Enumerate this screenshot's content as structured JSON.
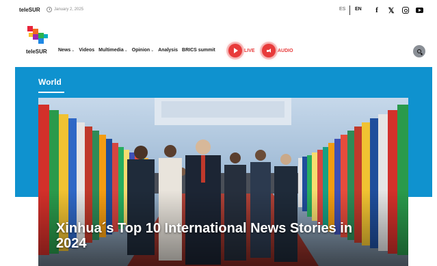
{
  "topbar": {
    "brand": "teleSUR",
    "date": "January 2, 2025",
    "lang_es": "ES",
    "lang_en": "EN"
  },
  "nav": {
    "logo_text": "teleSUR",
    "menu": [
      {
        "label": "News",
        "dropdown": true
      },
      {
        "label": "Videos",
        "dropdown": false
      },
      {
        "label": "Multimedia",
        "dropdown": true
      },
      {
        "label": "Opinion",
        "dropdown": true
      },
      {
        "label": "Analysis",
        "dropdown": false
      },
      {
        "label": "BRICS summit",
        "dropdown": false
      }
    ],
    "chevron": "⌄",
    "live_label": "LIVE",
    "audio_label": "AUDIO"
  },
  "hero": {
    "section": "World",
    "headline": "Xinhua´s Top 10 International News Stories in 2024"
  },
  "colors": {
    "accent_blue": "#0f92cf",
    "live_red": "#e83b3b"
  },
  "icons": [
    "clock-icon",
    "facebook-icon",
    "x-icon",
    "instagram-icon",
    "youtube-icon",
    "play-icon",
    "speaker-icon",
    "search-icon"
  ]
}
